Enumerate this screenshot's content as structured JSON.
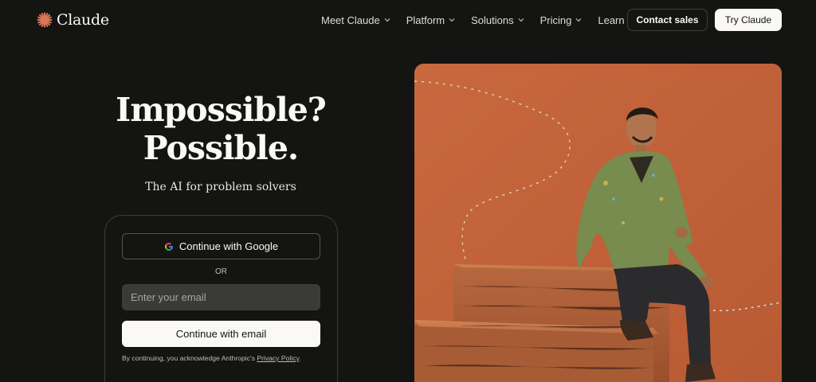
{
  "nav": {
    "brand": "Claude",
    "menu": [
      "Meet Claude",
      "Platform",
      "Solutions",
      "Pricing",
      "Learn"
    ],
    "contact_label": "Contact sales",
    "try_label": "Try Claude"
  },
  "hero": {
    "title_line1": "Impossible?",
    "title_line2": "Possible.",
    "subtitle": "The AI for problem solvers"
  },
  "signup": {
    "google_label": "Continue with Google",
    "or_label": "OR",
    "email_placeholder": "Enter your email",
    "email_button_label": "Continue with email",
    "legal_prefix": "By continuing, you acknowledge Anthropic's ",
    "privacy_link": "Privacy Policy",
    "legal_suffix": "."
  },
  "colors": {
    "background": "#141413",
    "accent": "#d97757",
    "image_background": "#c8673e",
    "light": "#faf9f5"
  }
}
